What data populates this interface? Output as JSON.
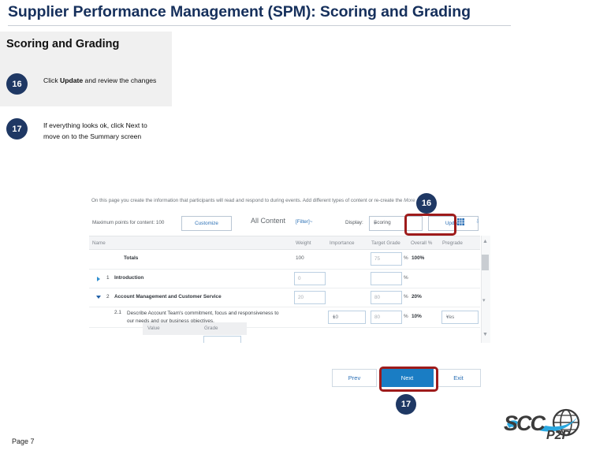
{
  "slide": {
    "title": "Supplier Performance Management (SPM): Scoring and Grading",
    "page_number": "Page 7",
    "accent_navy": "#1f3864",
    "highlight_red": "#9e1b1b",
    "primary_blue": "#1a7dc4"
  },
  "steps_panel": {
    "heading": "Scoring and Grading",
    "steps": [
      {
        "number": "16",
        "text_before": "Click ",
        "text_bold": "Update",
        "text_after": " and review the changes"
      },
      {
        "number": "17",
        "text": "If everything looks ok, click Next to move on to the Summary screen"
      }
    ]
  },
  "screenshot": {
    "intro_text": "On this page you create the information that participants will read and respond to during events.  Add different types of content or re-create the",
    "intro_more": "More",
    "toolbar": {
      "max_points_label": "Maximum points for content:  100",
      "customize_button": "Customize",
      "all_content_label": "All Content",
      "filter_link": "[Filter]~",
      "display_label": "Display:",
      "display_value": "Scoring",
      "update_button": "Update",
      "grid_icon": "grid-icon",
      "expand_icon": "double-chevron-down-icon"
    },
    "table": {
      "columns": [
        "Name",
        "Weight",
        "Importance",
        "Target Grade",
        "Overall %",
        "Pregrade"
      ],
      "rows": [
        {
          "name": "Totals",
          "weight": "100",
          "importance": "",
          "target_grade": "75",
          "percent_symbol": "%",
          "overall": "100%",
          "pregrade": ""
        },
        {
          "index": "1",
          "name": "Introduction",
          "weight": "0",
          "importance": "",
          "target_grade": "",
          "percent_symbol": "%",
          "overall": "",
          "pregrade": ""
        },
        {
          "index": "2",
          "name": "Account Management and Customer Service",
          "weight": "20",
          "importance": "",
          "target_grade": "80",
          "percent_symbol": "%",
          "overall": "20%",
          "pregrade": ""
        },
        {
          "index": "2.1",
          "name": "Describe Account Team's commitment, focus and responsiveness to our needs and our business objectives.",
          "weight": "",
          "importance": "10",
          "target_grade": "80",
          "percent_symbol": "%",
          "overall": "10%",
          "pregrade": "Yes"
        }
      ],
      "subgrid": {
        "value_header": "Value",
        "grade_header": "Grade"
      }
    },
    "nav": {
      "prev": "Prev",
      "next": "Next",
      "exit": "Exit"
    }
  },
  "callouts": [
    {
      "number": "16"
    },
    {
      "number": "17"
    }
  ],
  "logo": {
    "mark": "SCC",
    "sub": "P2P",
    "globe_icon": "globe-icon"
  }
}
